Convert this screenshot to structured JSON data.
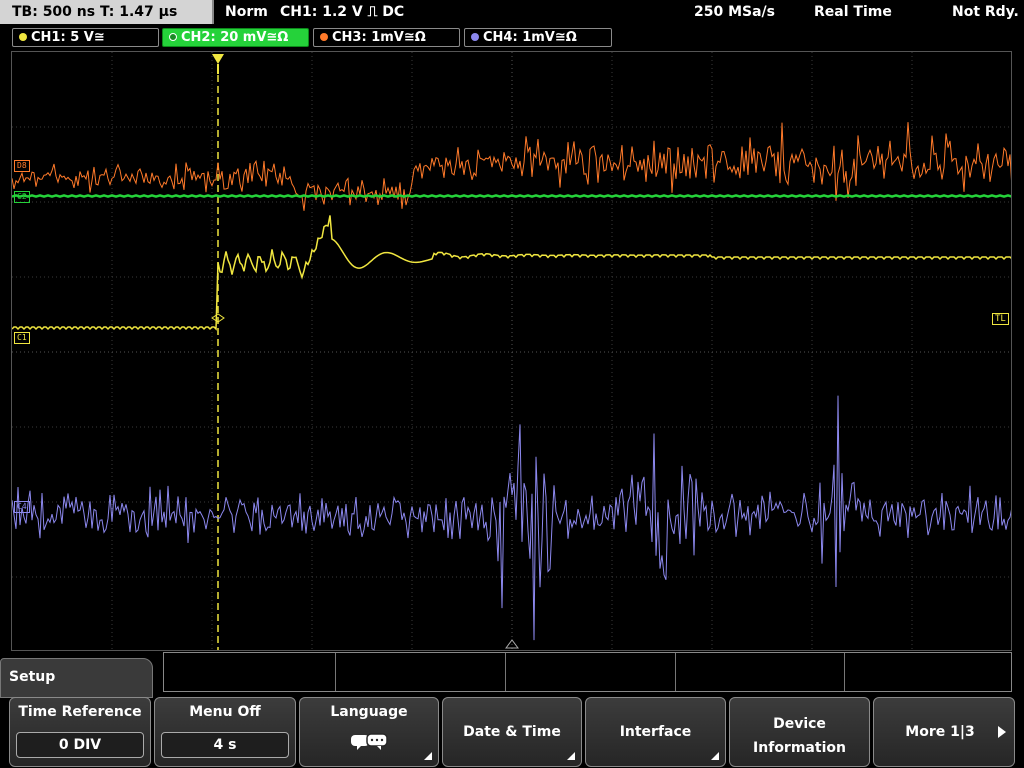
{
  "status": {
    "timebase": "TB: 500 ns   T: 1.47 µs",
    "mode": "Norm",
    "trigger": "CH1: 1.2 V ⎍ DC",
    "sample_rate": "250 MSa/s",
    "acq": "Real Time",
    "state": "Not Rdy."
  },
  "channels": [
    {
      "label": "CH1: 5 V≅",
      "color": "#f0e640"
    },
    {
      "label": "CH2: 20 mV≅Ω",
      "color": "#25d23a"
    },
    {
      "label": "CH3: 1mV≅Ω",
      "color": "#ff7a2a"
    },
    {
      "label": "CH4: 1mV≅Ω",
      "color": "#8c88ee"
    }
  ],
  "markers": {
    "d8": "D8",
    "c2": "C2",
    "c1": "C1",
    "c4": "C4",
    "tl": "TL"
  },
  "menu": {
    "tab": "Setup",
    "keys": [
      {
        "label": "Time Reference",
        "value": "0 DIV"
      },
      {
        "label": "Menu Off",
        "value": "4 s"
      },
      {
        "label": "Language"
      },
      {
        "label": "Date & Time"
      },
      {
        "label": "Interface"
      },
      {
        "label_line1": "Device",
        "label_line2": "Information"
      },
      {
        "label": "More 1|3"
      }
    ]
  },
  "colors": {
    "ch1": "#f0e640",
    "ch2": "#25d23a",
    "ch3": "#ff7a2a",
    "ch4": "#8c88ee",
    "grid": "#3a3a3a"
  }
}
